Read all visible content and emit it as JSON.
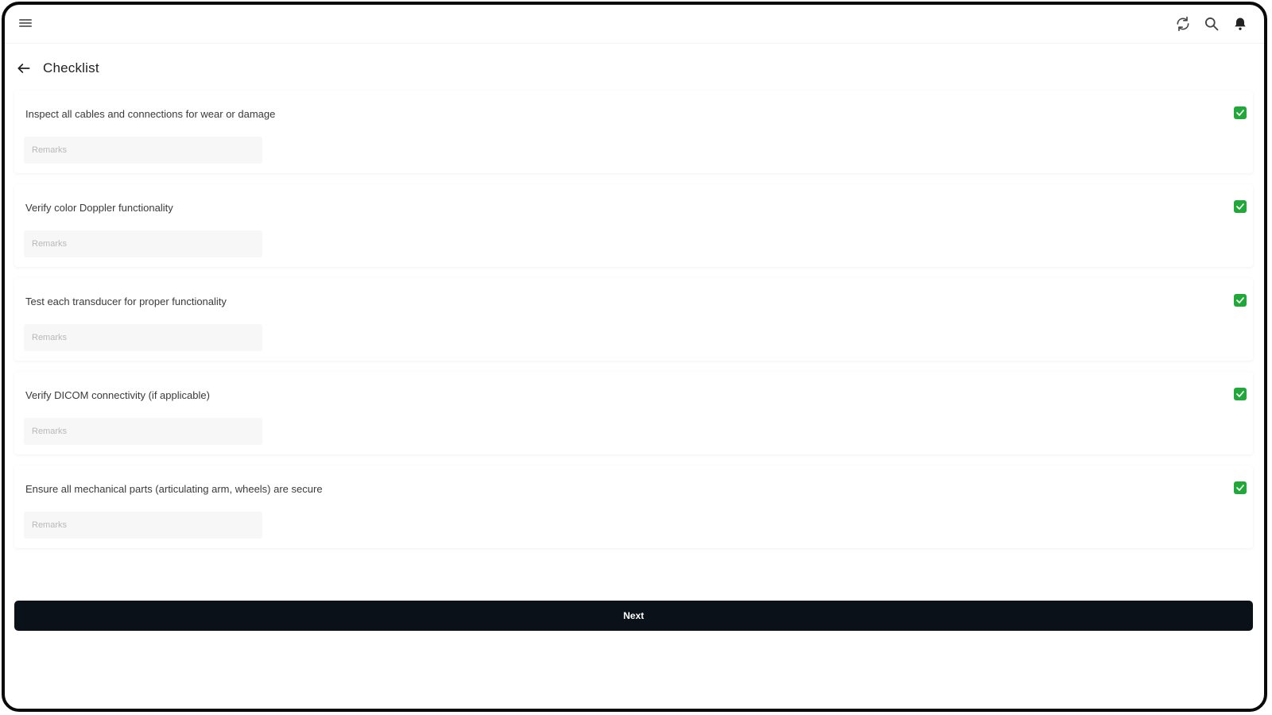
{
  "header": {
    "icons": [
      "menu-icon",
      "refresh-icon",
      "search-icon",
      "bell-icon"
    ],
    "back_icon": "arrow-left-icon",
    "title": "Checklist"
  },
  "checklist": {
    "items": [
      {
        "label": "Inspect all cables and connections for wear or damage",
        "checked": true,
        "remarks_placeholder": "Remarks",
        "remarks_value": ""
      },
      {
        "label": "Verify color Doppler functionality",
        "checked": true,
        "remarks_placeholder": "Remarks",
        "remarks_value": ""
      },
      {
        "label": "Test each transducer for proper functionality",
        "checked": true,
        "remarks_placeholder": "Remarks",
        "remarks_value": ""
      },
      {
        "label": "Verify DICOM connectivity (if applicable)",
        "checked": true,
        "remarks_placeholder": "Remarks",
        "remarks_value": ""
      },
      {
        "label": "Ensure all mechanical parts (articulating arm, wheels) are secure",
        "checked": true,
        "remarks_placeholder": "Remarks",
        "remarks_value": ""
      }
    ]
  },
  "footer": {
    "next_label": "Next"
  },
  "colors": {
    "check_green": "#22a83a",
    "button_bg": "#0b1118",
    "frame": "#0a0a0a"
  }
}
